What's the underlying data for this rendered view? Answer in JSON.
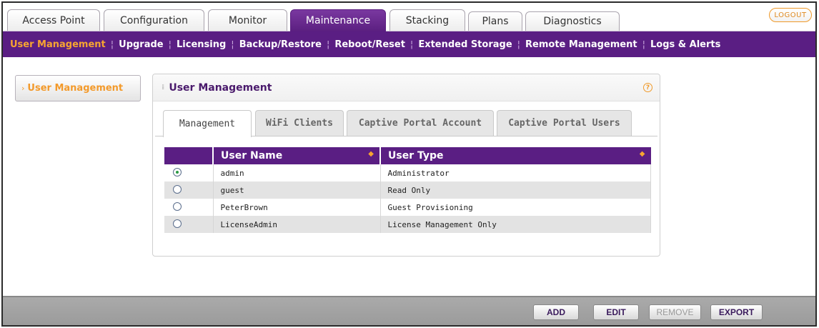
{
  "top_tabs": [
    "Access Point",
    "Configuration",
    "Monitor",
    "Maintenance",
    "Stacking",
    "Plans",
    "Diagnostics"
  ],
  "active_top_tab": "Maintenance",
  "logout_label": "LOGOUT",
  "submenu": [
    "User Management",
    "Upgrade",
    "Licensing",
    "Backup/Restore",
    "Reboot/Reset",
    "Extended Storage",
    "Remote Management",
    "Logs & Alerts"
  ],
  "active_submenu": "User Management",
  "left_nav": {
    "item": "User Management"
  },
  "panel": {
    "title": "User Management",
    "help_icon": "?",
    "tabs": [
      "Management",
      "WiFi Clients",
      "Captive Portal Account",
      "Captive Portal Users"
    ],
    "active_tab": "Management"
  },
  "table": {
    "columns": [
      "User Name",
      "User Type"
    ],
    "rows": [
      {
        "name": "admin",
        "type": "Administrator",
        "selected": true
      },
      {
        "name": "guest",
        "type": "Read Only",
        "selected": false
      },
      {
        "name": "PeterBrown",
        "type": "Guest Provisioning",
        "selected": false
      },
      {
        "name": "LicenseAdmin",
        "type": "License Management Only",
        "selected": false
      }
    ]
  },
  "buttons": {
    "add": "ADD",
    "edit": "EDIT",
    "remove": "REMOVE",
    "export": "EXPORT"
  },
  "colors": {
    "brand_purple": "#5a1e83",
    "accent_orange": "#f7a531"
  }
}
